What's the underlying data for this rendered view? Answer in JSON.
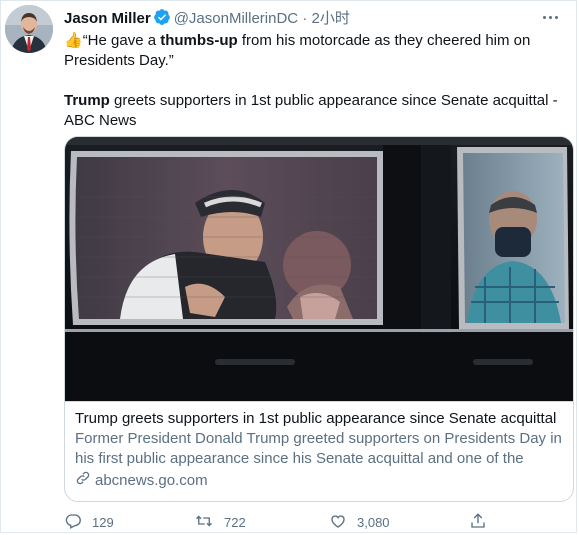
{
  "tweet": {
    "author_name": "Jason Miller",
    "handle": "@JasonMillerinDC",
    "separator": "·",
    "time": "2小时",
    "body": {
      "line1_emoji": "👍",
      "line1_pre": "“He gave a ",
      "line1_bold": "thumbs-up",
      "line1_post": " from his motorcade as they cheered him on Presidents Day.”",
      "line2_bold": "Trump",
      "line2_post": " greets supporters in 1st public appearance since Senate acquittal - ABC News"
    }
  },
  "card": {
    "title": "Trump greets supporters in 1st public appearance since Senate acquittal",
    "description": "Former President Donald Trump greeted supporters on Presidents Day in his first public appearance since his Senate acquittal and one of the first...",
    "domain": "abcnews.go.com"
  },
  "actions": {
    "replies": "129",
    "retweets": "722",
    "likes": "3,080"
  },
  "colors": {
    "verified": "#1da1f2",
    "secondary_text": "#5b7083",
    "border": "#cfd9de"
  },
  "icons": [
    "avatar",
    "verified-badge-icon",
    "more-icon",
    "link-icon",
    "reply-icon",
    "retweet-icon",
    "like-icon",
    "share-icon"
  ]
}
